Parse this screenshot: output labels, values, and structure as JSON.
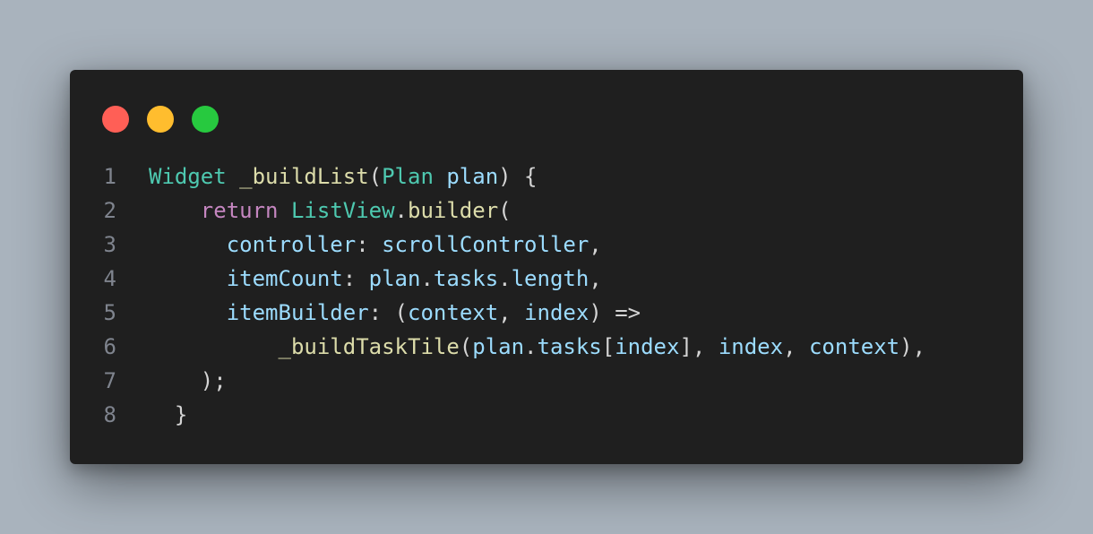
{
  "window": {
    "traffic_lights": [
      {
        "name": "close",
        "color": "#ff5f56"
      },
      {
        "name": "minimize",
        "color": "#ffbd2e"
      },
      {
        "name": "maximize",
        "color": "#27c93f"
      }
    ]
  },
  "code": {
    "language": "dart",
    "lines": [
      {
        "number": "1",
        "tokens": [
          {
            "text": "Widget",
            "kind": "type"
          },
          {
            "text": " ",
            "kind": "punc"
          },
          {
            "text": "_buildList",
            "kind": "fn"
          },
          {
            "text": "(",
            "kind": "punc"
          },
          {
            "text": "Plan",
            "kind": "type"
          },
          {
            "text": " ",
            "kind": "punc"
          },
          {
            "text": "plan",
            "kind": "var"
          },
          {
            "text": ") {",
            "kind": "punc"
          }
        ]
      },
      {
        "number": "2",
        "tokens": [
          {
            "text": "    ",
            "kind": "punc"
          },
          {
            "text": "return",
            "kind": "ctrl"
          },
          {
            "text": " ",
            "kind": "punc"
          },
          {
            "text": "ListView",
            "kind": "type"
          },
          {
            "text": ".",
            "kind": "punc"
          },
          {
            "text": "builder",
            "kind": "fn"
          },
          {
            "text": "(",
            "kind": "punc"
          }
        ]
      },
      {
        "number": "3",
        "tokens": [
          {
            "text": "      ",
            "kind": "punc"
          },
          {
            "text": "controller",
            "kind": "var"
          },
          {
            "text": ": ",
            "kind": "punc"
          },
          {
            "text": "scrollController",
            "kind": "var"
          },
          {
            "text": ",",
            "kind": "punc"
          }
        ]
      },
      {
        "number": "4",
        "tokens": [
          {
            "text": "      ",
            "kind": "punc"
          },
          {
            "text": "itemCount",
            "kind": "var"
          },
          {
            "text": ": ",
            "kind": "punc"
          },
          {
            "text": "plan",
            "kind": "var"
          },
          {
            "text": ".",
            "kind": "punc"
          },
          {
            "text": "tasks",
            "kind": "var"
          },
          {
            "text": ".",
            "kind": "punc"
          },
          {
            "text": "length",
            "kind": "var"
          },
          {
            "text": ",",
            "kind": "punc"
          }
        ]
      },
      {
        "number": "5",
        "tokens": [
          {
            "text": "      ",
            "kind": "punc"
          },
          {
            "text": "itemBuilder",
            "kind": "var"
          },
          {
            "text": ": (",
            "kind": "punc"
          },
          {
            "text": "context",
            "kind": "var"
          },
          {
            "text": ", ",
            "kind": "punc"
          },
          {
            "text": "index",
            "kind": "var"
          },
          {
            "text": ") =>",
            "kind": "punc"
          }
        ]
      },
      {
        "number": "6",
        "tokens": [
          {
            "text": "          ",
            "kind": "punc"
          },
          {
            "text": "_buildTaskTile",
            "kind": "fn"
          },
          {
            "text": "(",
            "kind": "punc"
          },
          {
            "text": "plan",
            "kind": "var"
          },
          {
            "text": ".",
            "kind": "punc"
          },
          {
            "text": "tasks",
            "kind": "var"
          },
          {
            "text": "[",
            "kind": "punc"
          },
          {
            "text": "index",
            "kind": "var"
          },
          {
            "text": "], ",
            "kind": "punc"
          },
          {
            "text": "index",
            "kind": "var"
          },
          {
            "text": ", ",
            "kind": "punc"
          },
          {
            "text": "context",
            "kind": "var"
          },
          {
            "text": "),",
            "kind": "punc"
          }
        ]
      },
      {
        "number": "7",
        "tokens": [
          {
            "text": "    ",
            "kind": "punc"
          },
          {
            "text": ");",
            "kind": "punc"
          }
        ]
      },
      {
        "number": "8",
        "tokens": [
          {
            "text": "  ",
            "kind": "punc"
          },
          {
            "text": "}",
            "kind": "punc"
          }
        ]
      }
    ]
  }
}
